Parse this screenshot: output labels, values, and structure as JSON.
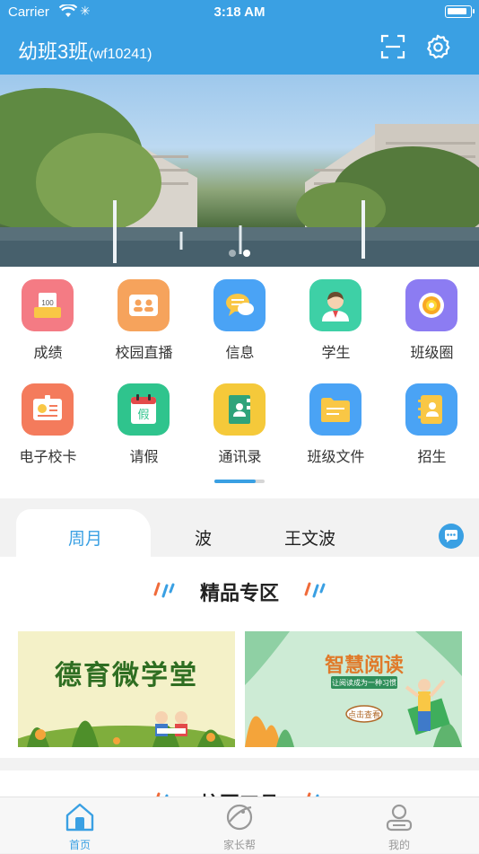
{
  "status_bar": {
    "carrier": "Carrier",
    "time": "3:18 AM"
  },
  "header": {
    "title": "幼班3班",
    "class_code": "(wf10241)",
    "scan_icon": "scan-icon",
    "settings_icon": "gear-icon"
  },
  "banner": {
    "page_count": 2,
    "active_page": 2
  },
  "quick_menu": [
    {
      "label": "成绩",
      "icon": "scores-icon",
      "color": "#f47b84"
    },
    {
      "label": "校园直播",
      "icon": "campus-live-icon",
      "color": "#f6a35c"
    },
    {
      "label": "信息",
      "icon": "message-icon",
      "color": "#4aa3f5"
    },
    {
      "label": "学生",
      "icon": "student-icon",
      "color": "#3ed0a6"
    },
    {
      "label": "班级圈",
      "icon": "class-circle-icon",
      "color": "#8c7cf2"
    },
    {
      "label": "电子校卡",
      "icon": "school-card-icon",
      "color": "#f47b5c"
    },
    {
      "label": "请假",
      "icon": "leave-icon",
      "color": "#2fc48d"
    },
    {
      "label": "通讯录",
      "icon": "contacts-icon",
      "color": "#f5c93a"
    },
    {
      "label": "班级文件",
      "icon": "class-files-icon",
      "color": "#4aa3f5"
    },
    {
      "label": "招生",
      "icon": "enrollment-icon",
      "color": "#4aa3f5"
    }
  ],
  "tabs": [
    {
      "label": "周月",
      "selected": true
    },
    {
      "label": "波",
      "selected": false
    },
    {
      "label": "王文波",
      "selected": false
    }
  ],
  "premium": {
    "title": "精品专区",
    "cards": [
      {
        "title": "德育微学堂"
      },
      {
        "title": "智慧阅读",
        "subtitle": "让阅读成为一种习惯",
        "button": "点击查看"
      }
    ]
  },
  "section2": {
    "title": "校园工具"
  },
  "tabbar": [
    {
      "label": "首页",
      "icon": "home-icon",
      "selected": true
    },
    {
      "label": "家长帮",
      "icon": "parent-help-icon",
      "selected": false
    },
    {
      "label": "我的",
      "icon": "profile-icon",
      "selected": false
    }
  ],
  "colors": {
    "accent": "#3aa0e3"
  }
}
